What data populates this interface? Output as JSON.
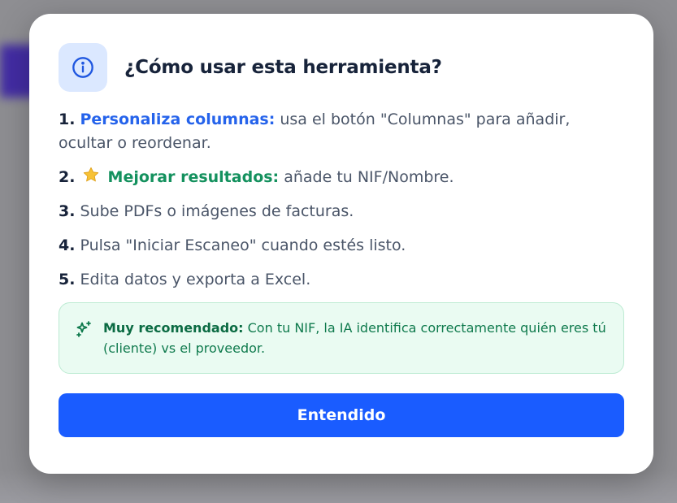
{
  "dialog": {
    "title": "¿Cómo usar esta herramienta?",
    "info_icon": "info-circle-icon",
    "steps": [
      {
        "number": "1.",
        "highlight": "Personaliza columnas:",
        "text": " usa el botón \"Columnas\" para añadir, ocultar o reordenar."
      },
      {
        "number": "2.",
        "icon": "star-icon",
        "highlight": "Mejorar resultados:",
        "text": " añade tu NIF/Nombre."
      },
      {
        "number": "3.",
        "text": " Sube PDFs o imágenes de facturas."
      },
      {
        "number": "4.",
        "text": " Pulsa \"Iniciar Escaneo\" cuando estés listo."
      },
      {
        "number": "5.",
        "text": " Edita datos y exporta a Excel."
      }
    ],
    "tip": {
      "icon": "sparkles-icon",
      "strong": "Muy recomendado:",
      "text": " Con tu NIF, la IA identifica correctamente quién eres tú (cliente) vs el proveedor."
    },
    "confirm_label": "Entendido"
  },
  "colors": {
    "accent_blue": "#2563eb",
    "accent_green": "#14915e",
    "button": "#1a5cff",
    "tip_bg": "#eafbf2"
  }
}
